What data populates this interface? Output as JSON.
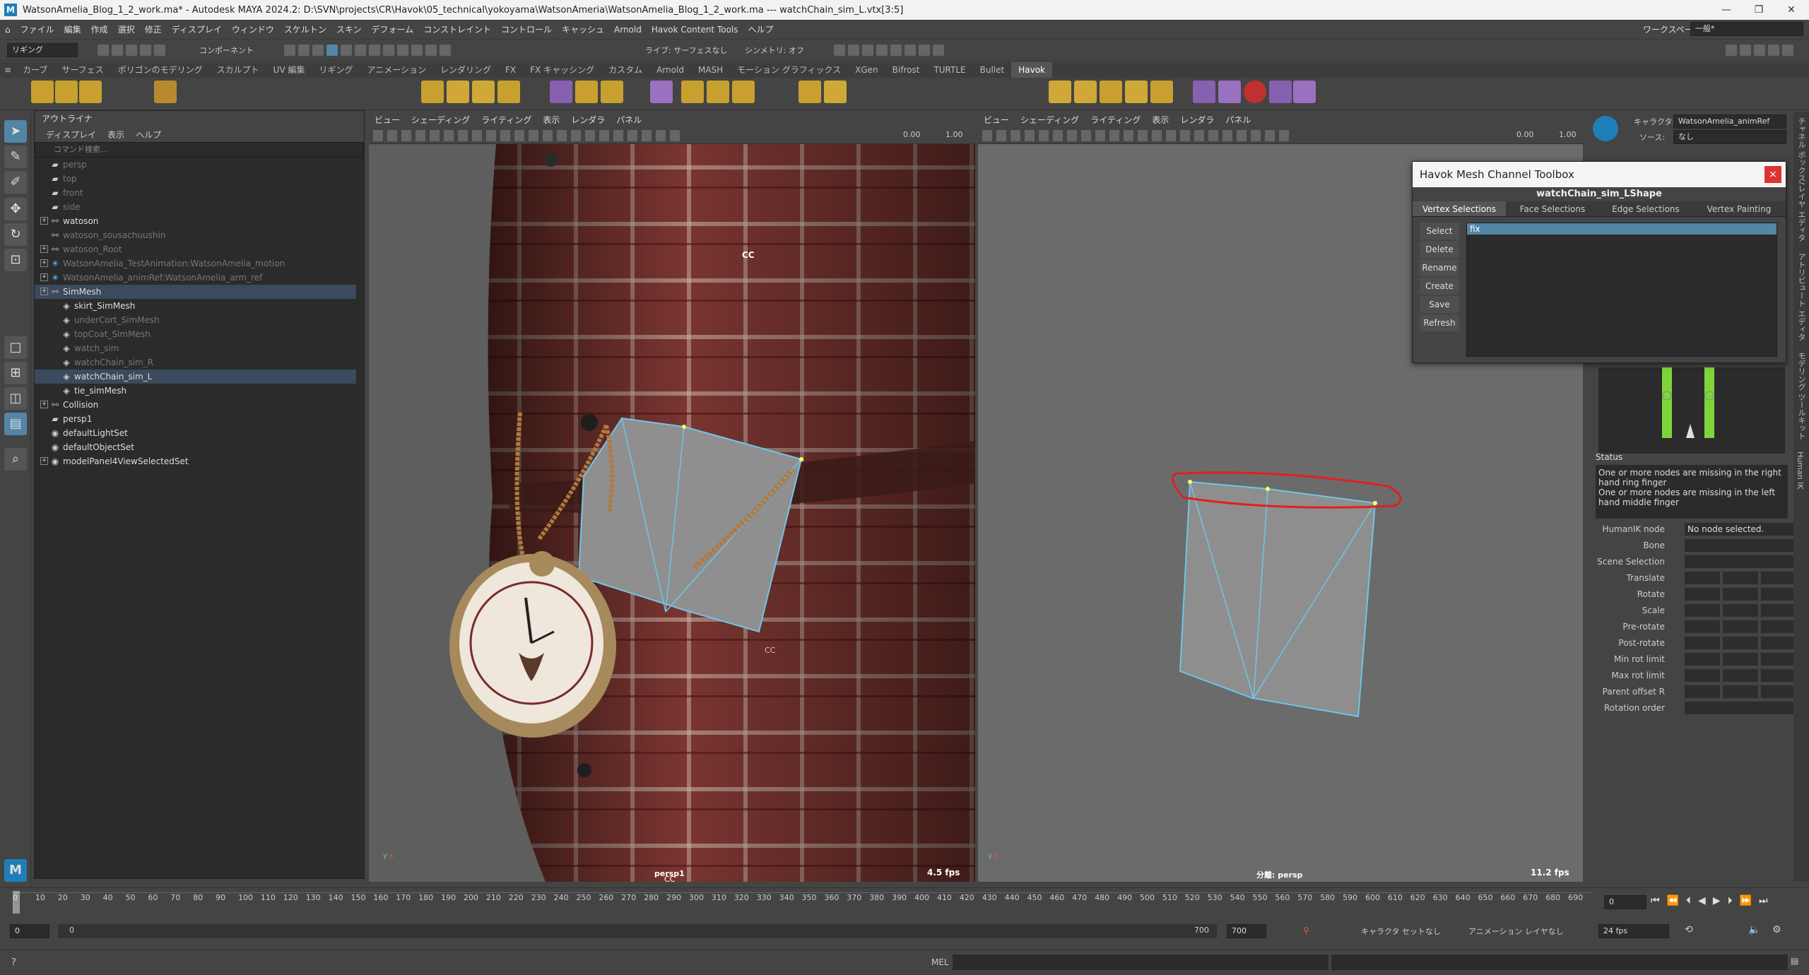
{
  "window": {
    "title": "WatsonAmelia_Blog_1_2_work.ma* - Autodesk MAYA 2024.2: D:\\SVN\\projects\\CR\\Havok\\05_technical\\yokoyama\\WatsonAmeria\\WatsonAmelia_Blog_1_2_work.ma  ---  watchChain_sim_L.vtx[3:5]",
    "min": "—",
    "max": "❐",
    "close": "✕"
  },
  "menubar": {
    "items": [
      "ファイル",
      "編集",
      "作成",
      "選択",
      "修正",
      "ディスプレイ",
      "ウィンドウ",
      "スケルトン",
      "スキン",
      "デフォーム",
      "コンストレイント",
      "コントロール",
      "キャッシュ",
      "Arnold",
      "Havok Content Tools",
      "ヘルプ"
    ],
    "workspace_label": "ワークスペース:",
    "workspace_value": "一般*"
  },
  "statusline": {
    "menuset": "リギング",
    "component": "コンポーネント",
    "surface": "ライブ: サーフェスなし",
    "symmetry": "シンメトリ: オフ"
  },
  "shelf": {
    "tabs": [
      "カーブ",
      "サーフェス",
      "ポリゴンのモデリング",
      "スカルプト",
      "UV 編集",
      "リギング",
      "アニメーション",
      "レンダリング",
      "FX",
      "FX キャッシング",
      "カスタム",
      "Arnold",
      "MASH",
      "モーション グラフィックス",
      "XGen",
      "Bifrost",
      "TURTLE",
      "Bullet",
      "Havok"
    ],
    "active": "Havok"
  },
  "outliner": {
    "title": "アウトライナ",
    "menu": [
      "ディスプレイ",
      "表示",
      "ヘルプ"
    ],
    "search_placeholder": "コマンド検索...",
    "items": [
      {
        "label": "persp",
        "dim": true,
        "indent": 0,
        "icon": "camera"
      },
      {
        "label": "top",
        "dim": true,
        "indent": 0,
        "icon": "camera"
      },
      {
        "label": "front",
        "dim": true,
        "indent": 0,
        "icon": "camera"
      },
      {
        "label": "side",
        "dim": true,
        "indent": 0,
        "icon": "camera"
      },
      {
        "label": "watoson",
        "dim": false,
        "indent": 0,
        "icon": "joint",
        "exp": true
      },
      {
        "label": "watoson_sousachuushin",
        "dim": true,
        "indent": 0,
        "icon": "joint"
      },
      {
        "label": "watoson_Root",
        "dim": true,
        "indent": 0,
        "icon": "joint",
        "exp": true
      },
      {
        "label": "WatsonAmelia_TestAnimation:WatsonAmelia_motion",
        "dim": true,
        "indent": 0,
        "icon": "star",
        "exp": true
      },
      {
        "label": "WatsonAmelia_animRef:WatsonAmelia_arm_ref",
        "dim": true,
        "indent": 0,
        "icon": "star",
        "exp": true
      },
      {
        "label": "SimMesh",
        "dim": false,
        "indent": 0,
        "icon": "joint",
        "exp": true,
        "hl": true
      },
      {
        "label": "skirt_SimMesh",
        "dim": false,
        "indent": 1,
        "icon": "mesh"
      },
      {
        "label": "underCort_SimMesh",
        "dim": true,
        "indent": 1,
        "icon": "mesh"
      },
      {
        "label": "topCoat_SimMesh",
        "dim": true,
        "indent": 1,
        "icon": "mesh"
      },
      {
        "label": "watch_sim",
        "dim": true,
        "indent": 1,
        "icon": "mesh"
      },
      {
        "label": "watchChain_sim_R",
        "dim": true,
        "indent": 1,
        "icon": "mesh"
      },
      {
        "label": "watchChain_sim_L",
        "dim": false,
        "indent": 1,
        "icon": "mesh",
        "hl": true
      },
      {
        "label": "tie_simMesh",
        "dim": false,
        "indent": 1,
        "icon": "mesh"
      },
      {
        "label": "Collision",
        "dim": false,
        "indent": 0,
        "icon": "joint",
        "exp": true
      },
      {
        "label": "persp1",
        "dim": false,
        "indent": 0,
        "icon": "camera"
      },
      {
        "label": "defaultLightSet",
        "dim": false,
        "indent": 0,
        "icon": "set"
      },
      {
        "label": "defaultObjectSet",
        "dim": false,
        "indent": 0,
        "icon": "set"
      },
      {
        "label": "modelPanel4ViewSelectedSet",
        "dim": false,
        "indent": 0,
        "icon": "set",
        "exp": true
      }
    ]
  },
  "viewport_left": {
    "menu": [
      "ビュー",
      "シェーディング",
      "ライティング",
      "表示",
      "レンダラ",
      "パネル"
    ],
    "camera": "persp1",
    "fps": "4.5 fps",
    "cc1": "CC",
    "cc2": "CC",
    "cc3": "CC",
    "val1": "0.00",
    "val2": "1.00"
  },
  "viewport_right": {
    "menu": [
      "ビュー",
      "シェーディング",
      "ライティング",
      "表示",
      "レンダラ",
      "パネル"
    ],
    "camera": "分離: persp",
    "fps": "11.2 fps",
    "val1": "0.00",
    "val2": "1.00"
  },
  "havok": {
    "title": "Havok Mesh Channel Toolbox",
    "close": "×",
    "shape": "watchChain_sim_LShape",
    "tabs": [
      "Vertex Selections",
      "Face Selections",
      "Edge Selections",
      "Vertex Painting"
    ],
    "active_tab": "Vertex Selections",
    "buttons": [
      "Select",
      "Delete",
      "Rename",
      "Create",
      "Save",
      "Refresh"
    ],
    "list": [
      "fix"
    ]
  },
  "humanik": {
    "character_label": "キャラクタ:",
    "character_value": "WatsonAmelia_animRef",
    "source_label": "ソース:",
    "source_value": "なし",
    "status_title": "Status",
    "status_lines": [
      "One or more nodes are missing in the right hand ring finger",
      "One or more nodes are missing in the left hand middle finger"
    ],
    "node_label": "HumanIK node",
    "node_value": "No node selected.",
    "attrs": [
      "Bone",
      "Scene Selection",
      "Translate",
      "Rotate",
      "Scale",
      "Pre-rotate",
      "Post-rotate",
      "Min rot limit",
      "Max rot limit",
      "Parent offset R",
      "Rotation order"
    ]
  },
  "sidetabs": [
    "チャネル ボックス/レイヤ エディタ",
    "アトリビュート エディタ",
    "モデリング ツールキット",
    "Human IK"
  ],
  "timeline": {
    "ticks": [
      "0",
      "10",
      "20",
      "30",
      "40",
      "50",
      "60",
      "70",
      "80",
      "90",
      "100",
      "110",
      "120",
      "130",
      "140",
      "150",
      "160",
      "170",
      "180",
      "190",
      "200",
      "210",
      "220",
      "230",
      "240",
      "250",
      "260",
      "270",
      "280",
      "290",
      "300",
      "310",
      "320",
      "330",
      "340",
      "350",
      "360",
      "370",
      "380",
      "390",
      "400",
      "410",
      "420",
      "430",
      "440",
      "450",
      "460",
      "470",
      "480",
      "490",
      "500",
      "510",
      "520",
      "530",
      "540",
      "550",
      "560",
      "570",
      "580",
      "590",
      "600",
      "610",
      "620",
      "630",
      "640",
      "650",
      "660",
      "670",
      "680",
      "690"
    ],
    "current": "0"
  },
  "range": {
    "start": "0",
    "start_inner": "0",
    "end_inner": "700",
    "end": "700",
    "character": "キャラクタ セットなし",
    "anim_layer": "アニメーション レイヤなし",
    "fps": "24 fps"
  },
  "cmdline": {
    "mel": "MEL",
    "help": "?"
  }
}
